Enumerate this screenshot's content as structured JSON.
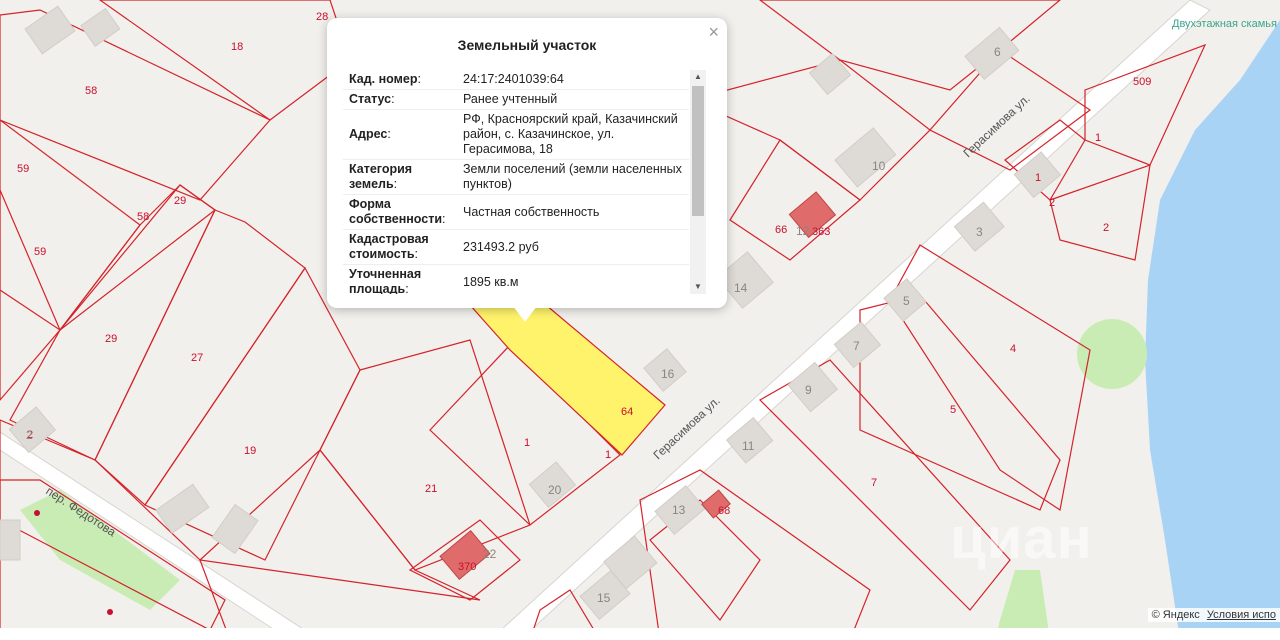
{
  "popup": {
    "title": "Земельный участок",
    "close_glyph": "×",
    "rows": [
      {
        "key": "Кад. номер",
        "value": "24:17:2401039:64"
      },
      {
        "key": "Статус",
        "value": "Ранее учтенный"
      },
      {
        "key": "Адрес",
        "value": "РФ, Красноярский край, Казачинский район, с. Казачинское, ул. Герасимова, 18"
      },
      {
        "key": "Категория земель",
        "value": "Земли поселений (земли населенных пунктов)"
      },
      {
        "key": "Форма собственности",
        "value": "Частная собственность"
      },
      {
        "key": "Кадастровая стоимость",
        "value": "231493.2 руб"
      },
      {
        "key": "Уточненная площадь",
        "value": "1895 кв.м"
      }
    ],
    "scroll_up_glyph": "▲",
    "scroll_down_glyph": "▼"
  },
  "map": {
    "plot_labels": [
      "28",
      "18",
      "58",
      "59",
      "58",
      "29",
      "59",
      "29",
      "27",
      "19",
      "21",
      "1",
      "64",
      "1",
      "2",
      "66",
      "363",
      "1",
      "509",
      "1",
      "2",
      "2",
      "4",
      "5",
      "7",
      "370",
      "68"
    ],
    "house_numbers": [
      "6",
      "10",
      "12",
      "3",
      "5",
      "7",
      "14",
      "16",
      "9",
      "11",
      "20",
      "13",
      "22",
      "15",
      "2"
    ],
    "streets": [
      "Герасимова ул.",
      "Герасимова ул.",
      "пер. Федотова"
    ],
    "poi": "Двухэтажная скамья",
    "colors": {
      "plot_border": "#d4232a",
      "selected_fill": "#fff36b",
      "water": "#a9d3f5",
      "green": "#c9ecb4",
      "house": "#dedad5",
      "house_red": "#e06b6b"
    }
  },
  "attribution": {
    "copyright": "© Яндекс",
    "terms": "Условия испо"
  },
  "watermark": "циан"
}
